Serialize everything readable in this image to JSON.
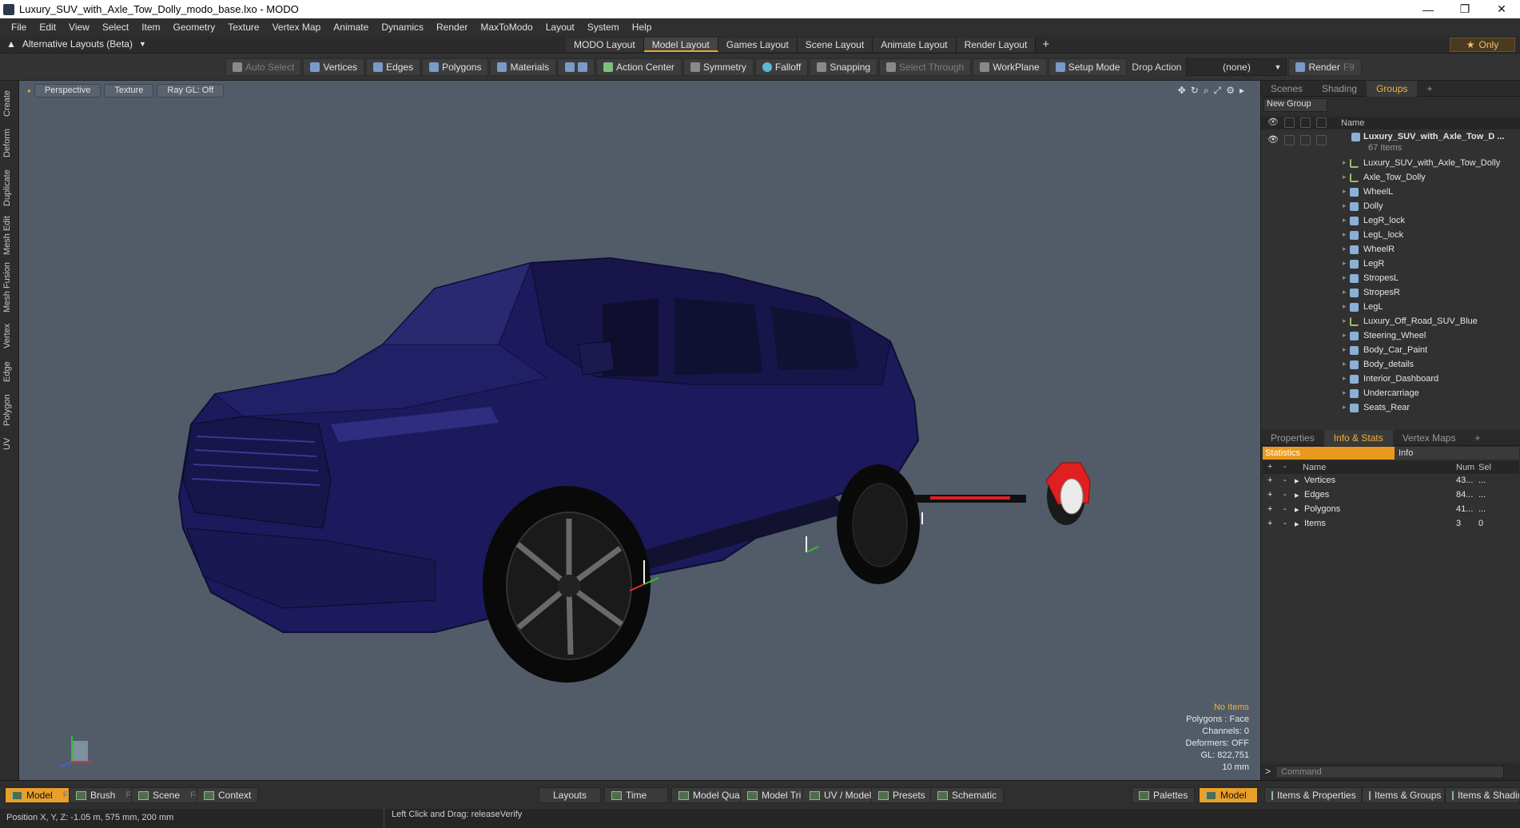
{
  "window": {
    "title": "Luxury_SUV_with_Axle_Tow_Dolly_modo_base.lxo - MODO",
    "controls": [
      "—",
      "❐",
      "✕"
    ]
  },
  "menu": [
    "File",
    "Edit",
    "View",
    "Select",
    "Item",
    "Geometry",
    "Texture",
    "Vertex Map",
    "Animate",
    "Dynamics",
    "Render",
    "MaxToModo",
    "Layout",
    "System",
    "Help"
  ],
  "layoutbar": {
    "alt_layouts": "Alternative Layouts (Beta)",
    "tabs": [
      "MODO Layout",
      "Model Layout",
      "Games Layout",
      "Scene Layout",
      "Animate Layout",
      "Render Layout"
    ],
    "active_tab": 1,
    "add": "+",
    "only": "Only"
  },
  "toolbar": {
    "auto_select": "Auto Select",
    "vertices": "Vertices",
    "edges": "Edges",
    "polygons": "Polygons",
    "materials": "Materials",
    "action_center": "Action Center",
    "symmetry": "Symmetry",
    "falloff": "Falloff",
    "snapping": "Snapping",
    "select_through": "Select Through",
    "workplane": "WorkPlane",
    "setup_mode": "Setup Mode",
    "drop_action": "Drop Action",
    "drop_value": "(none)",
    "render": "Render",
    "render_key": "F9"
  },
  "left_tabs": [
    "Create",
    "Deform",
    "Duplicate",
    "Mesh Edit",
    "Mesh Fusion",
    "Vertex",
    "Edge",
    "Polygon",
    "UV"
  ],
  "viewport": {
    "view": "Perspective",
    "shading": "Texture",
    "raygl": "Ray GL: Off",
    "stats": {
      "no_items": "No Items",
      "polygons": "Polygons : Face",
      "channels": "Channels: 0",
      "deformers": "Deformers: OFF",
      "gl": "GL: 822,751",
      "scale": "10 mm"
    }
  },
  "scene_panel": {
    "tabs": [
      "Scenes",
      "Shading",
      "Groups"
    ],
    "active_tab": 2,
    "add": "+",
    "new_group": "New Group",
    "col_name": "Name",
    "root": "Luxury_SUV_with_Axle_Tow_D ...",
    "root_count": "67 Items",
    "items": [
      {
        "label": "Luxury_SUV_with_Axle_Tow_Dolly",
        "kind": "locator"
      },
      {
        "label": "Axle_Tow_Dolly",
        "kind": "locator"
      },
      {
        "label": "WheelL",
        "kind": "mesh"
      },
      {
        "label": "Dolly",
        "kind": "mesh"
      },
      {
        "label": "LegR_lock",
        "kind": "mesh"
      },
      {
        "label": "LegL_lock",
        "kind": "mesh"
      },
      {
        "label": "WheelR",
        "kind": "mesh"
      },
      {
        "label": "LegR",
        "kind": "mesh"
      },
      {
        "label": "StropesL",
        "kind": "mesh"
      },
      {
        "label": "StropesR",
        "kind": "mesh"
      },
      {
        "label": "LegL",
        "kind": "mesh"
      },
      {
        "label": "Luxury_Off_Road_SUV_Blue",
        "kind": "locator"
      },
      {
        "label": "Steering_Wheel",
        "kind": "mesh"
      },
      {
        "label": "Body_Car_Paint",
        "kind": "mesh"
      },
      {
        "label": "Body_details",
        "kind": "mesh"
      },
      {
        "label": "Interior_Dashboard",
        "kind": "mesh"
      },
      {
        "label": "Undercarriage",
        "kind": "mesh"
      },
      {
        "label": "Seats_Rear",
        "kind": "mesh"
      }
    ]
  },
  "props_panel": {
    "tabs": [
      "Properties",
      "Info & Stats",
      "Vertex Maps"
    ],
    "active_tab": 1,
    "add": "+",
    "sub_tabs": [
      "Statistics",
      "Info"
    ],
    "columns": [
      "Name",
      "Num",
      "Sel"
    ],
    "rows": [
      {
        "name": "Vertices",
        "num": "43...",
        "sel": "..."
      },
      {
        "name": "Edges",
        "num": "84...",
        "sel": "..."
      },
      {
        "name": "Polygons",
        "num": "41...",
        "sel": "..."
      },
      {
        "name": "Items",
        "num": "3",
        "sel": "0"
      }
    ]
  },
  "command": {
    "placeholder": "Command",
    "arrow": ">"
  },
  "bottom": {
    "model": "Model",
    "model_key": "F2",
    "brush": "Brush",
    "brush_key": "F3",
    "scene": "Scene",
    "scene_key": "F4",
    "context": "Context",
    "layouts": "Layouts",
    "time": "Time",
    "model_quad": "Model Quad",
    "model_tri": "Model Tri",
    "uv_model": "UV / Model",
    "presets": "Presets",
    "schematic": "Schematic",
    "palettes": "Palettes",
    "model_right": "Model",
    "items_props": "Items & Properties",
    "items_groups": "Items & Groups",
    "items_shading": "Items & Shading"
  },
  "status": {
    "position": "Position X, Y, Z:   -1.05 m, 575 mm, 200 mm",
    "hint": "Left Click and Drag:  releaseVerify"
  },
  "colors": {
    "accent": "#e9a02a",
    "viewport_bg": "#525c69",
    "car_paint": "#1a1858",
    "dolly_red": "#e02020"
  }
}
